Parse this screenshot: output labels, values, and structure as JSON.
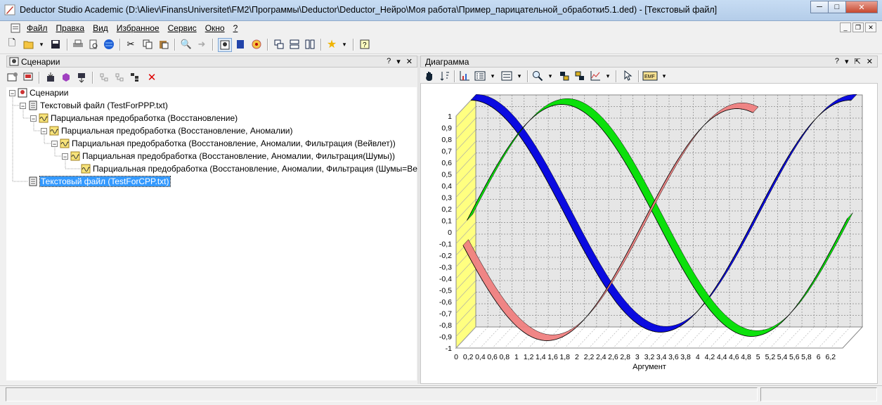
{
  "window": {
    "title": "Deductor Studio Academic (D:\\Aliev\\FinansUniversitet\\FM2\\Программы\\Deductor\\Deductor_Нейро\\Моя работа\\Пример_парицательной_обработки5.1.ded) - [Текстовый файл]",
    "minimize": "─",
    "maximize": "□",
    "close": "✕"
  },
  "menu": {
    "items": [
      "Файл",
      "Правка",
      "Вид",
      "Избранное",
      "Сервис",
      "Окно",
      "?"
    ]
  },
  "scenarios_panel": {
    "title": "Сценарии",
    "help": "?",
    "pin": "▾",
    "close": "✕",
    "tree": [
      {
        "label": "Сценарии",
        "level": 0,
        "icon": "scenarios-icon",
        "expander": "−"
      },
      {
        "label": "Текстовый файл (TestForPPP.txt)",
        "level": 1,
        "icon": "text-file-icon",
        "expander": "−"
      },
      {
        "label": "Парциальная предобработка (Восстановление)",
        "level": 2,
        "icon": "wave-icon",
        "expander": "−"
      },
      {
        "label": "Парциальная предобработка (Восстановление, Аномалии)",
        "level": 3,
        "icon": "wave-icon",
        "expander": "−"
      },
      {
        "label": "Парциальная предобработка (Восстановление, Аномалии, Фильтрация (Вейвлет))",
        "level": 4,
        "icon": "wave-icon",
        "expander": "−"
      },
      {
        "label": "Парциальная предобработка (Восстановление, Аномалии, Фильтрация(Шумы))",
        "level": 5,
        "icon": "wave-icon",
        "expander": "−"
      },
      {
        "label": "Парциальная предобработка (Восстановление, Аномалии, Фильтрация (Шумы=Вейвлет))",
        "level": 6,
        "icon": "wave-icon",
        "expander": ""
      },
      {
        "label": "Текстовый файл (TestForCPP.txt)",
        "level": 1,
        "icon": "text-file-icon",
        "expander": "",
        "selected": true
      }
    ]
  },
  "chart_panel": {
    "title": "Диаграмма",
    "help": "?",
    "pin": "▾",
    "float": "⇱",
    "close": "✕"
  },
  "chart_data": {
    "type": "line",
    "xlabel": "Аргумент",
    "ylabel": "",
    "title": "",
    "ylim": [
      -1,
      1
    ],
    "y_ticks": [
      "1",
      "0,9",
      "0,8",
      "0,7",
      "0,6",
      "0,5",
      "0,4",
      "0,3",
      "0,2",
      "0,1",
      "0",
      "-0,1",
      "-0,2",
      "-0,3",
      "-0,4",
      "-0,5",
      "-0,6",
      "-0,7",
      "-0,8",
      "-0,9",
      "-1"
    ],
    "x_ticks": [
      "0",
      "0,2",
      "0,4",
      "0,6",
      "0,8",
      "1",
      "1,2",
      "1,4",
      "1,6",
      "1,8",
      "2",
      "2,2",
      "2,4",
      "2,6",
      "2,8",
      "3",
      "3,2",
      "3,4",
      "3,6",
      "3,8",
      "4",
      "4,2",
      "4,4",
      "4,6",
      "4,8",
      "5",
      "5,2",
      "5,4",
      "5,6",
      "5,8",
      "6",
      "6,2"
    ],
    "xlim": [
      0,
      6.4
    ],
    "grid": true,
    "three_d": true,
    "series": [
      {
        "color": "#0000e0",
        "function": "cos",
        "x_start": 0,
        "x_end": 6.3
      },
      {
        "color": "#00e000",
        "function": "sin",
        "x_start": 0,
        "x_end": 6.3
      },
      {
        "color": "#f08080",
        "function": "cos_shift",
        "x_start": 0,
        "x_end": 4.8
      }
    ],
    "wall_color": "#ffff80"
  }
}
